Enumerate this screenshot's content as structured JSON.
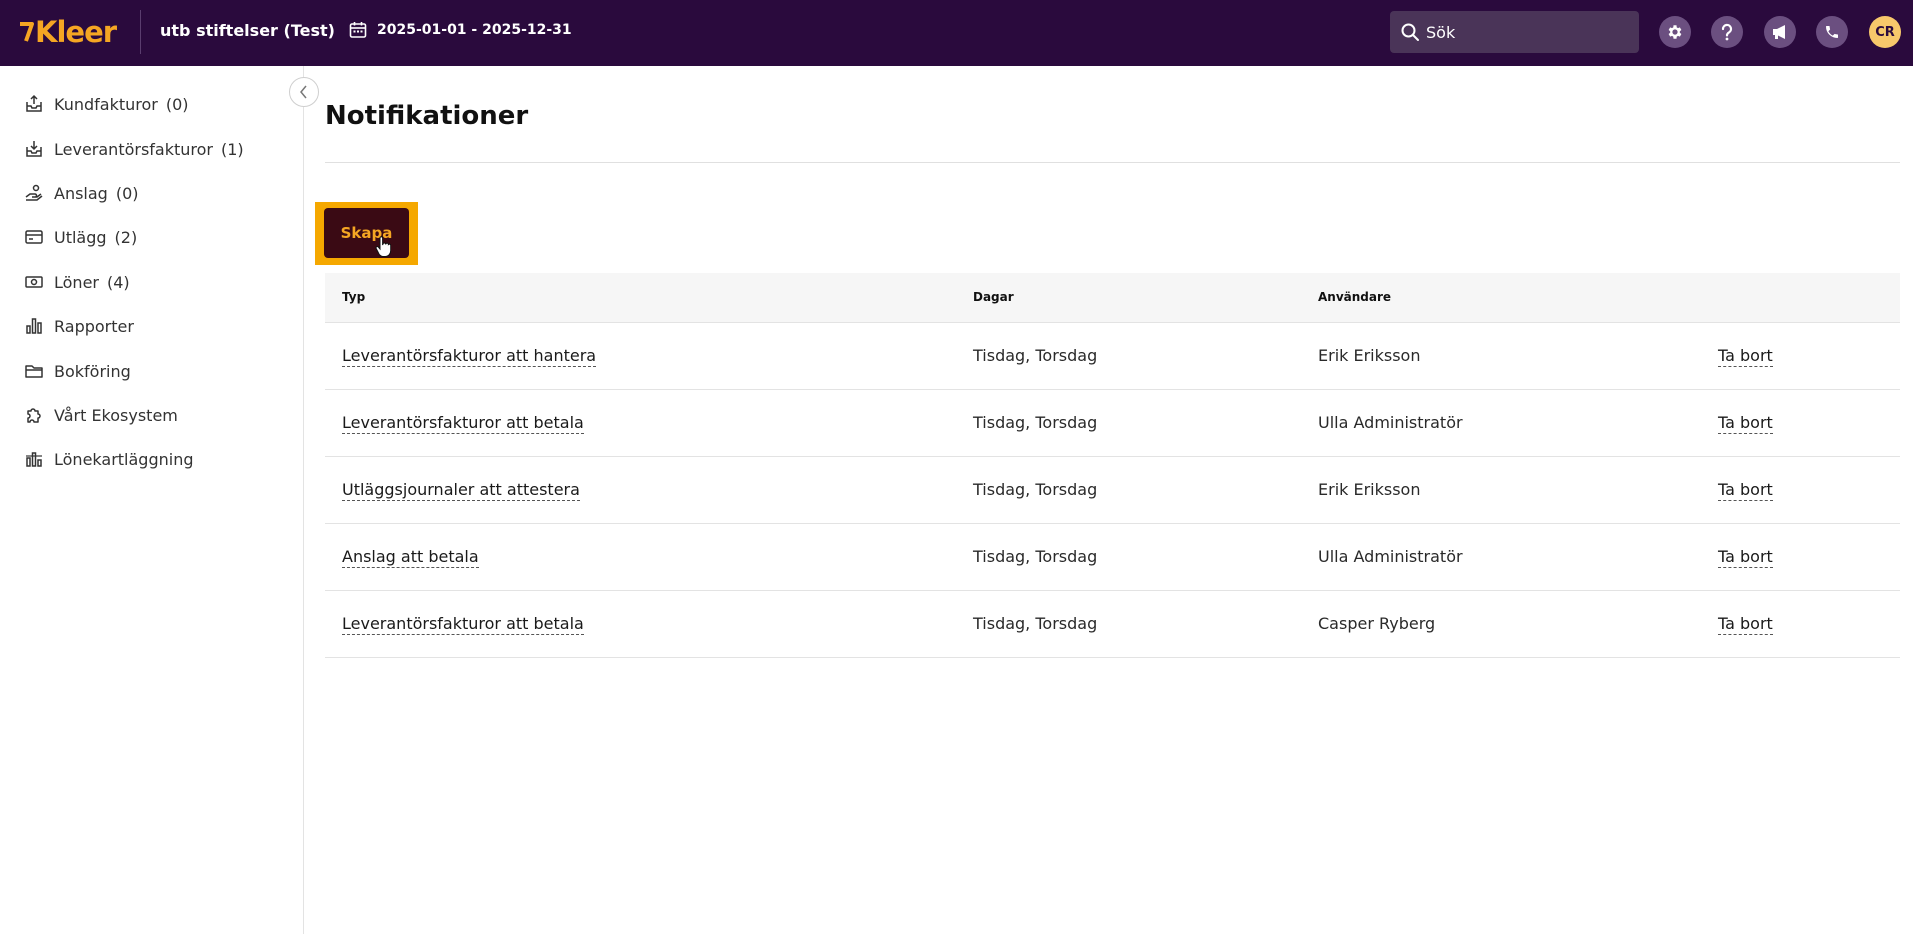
{
  "header": {
    "logo_text": "Kleer",
    "company": "utb stiftelser (Test)",
    "period": "2025-01-01 - 2025-12-31",
    "search_placeholder": "Sök",
    "avatar_initials": "CR",
    "icons": [
      "settings-icon",
      "help-icon",
      "announcement-icon",
      "phone-icon"
    ]
  },
  "sidebar": {
    "items": [
      {
        "label": "Kundfakturor",
        "count": "(0)",
        "icon": "invoice-out-icon"
      },
      {
        "label": "Leverantörsfakturor",
        "count": "(1)",
        "icon": "invoice-in-icon"
      },
      {
        "label": "Anslag",
        "count": "(0)",
        "icon": "grant-hand-icon"
      },
      {
        "label": "Utlägg",
        "count": "(2)",
        "icon": "card-icon"
      },
      {
        "label": "Löner",
        "count": "(4)",
        "icon": "cash-icon"
      },
      {
        "label": "Rapporter",
        "count": "",
        "icon": "bar-chart-icon"
      },
      {
        "label": "Bokföring",
        "count": "",
        "icon": "folder-icon"
      },
      {
        "label": "Vårt Ekosystem",
        "count": "",
        "icon": "puzzle-icon"
      },
      {
        "label": "Lönekartläggning",
        "count": "",
        "icon": "salary-chart-icon"
      }
    ]
  },
  "main": {
    "title": "Notifikationer",
    "create_label": "Skapa",
    "table": {
      "headers": [
        "Typ",
        "Dagar",
        "Användare"
      ],
      "rows": [
        {
          "type": "Leverantörsfakturor att hantera",
          "days": "Tisdag, Torsdag",
          "user": "Erik Eriksson",
          "action": "Ta bort"
        },
        {
          "type": "Leverantörsfakturor att betala",
          "days": "Tisdag, Torsdag",
          "user": "Ulla Administratör",
          "action": "Ta bort"
        },
        {
          "type": "Utläggsjournaler att attestera",
          "days": "Tisdag, Torsdag",
          "user": "Erik Eriksson",
          "action": "Ta bort"
        },
        {
          "type": "Anslag att betala",
          "days": "Tisdag, Torsdag",
          "user": "Ulla Administratör",
          "action": "Ta bort"
        },
        {
          "type": "Leverantörsfakturor att betala",
          "days": "Tisdag, Torsdag",
          "user": "Casper Ryberg",
          "action": "Ta bort"
        }
      ]
    }
  },
  "colors": {
    "topbar": "#2a0a3d",
    "accent": "#f5a623",
    "create_highlight": "#f5a800",
    "create_button": "#3a0a14"
  }
}
